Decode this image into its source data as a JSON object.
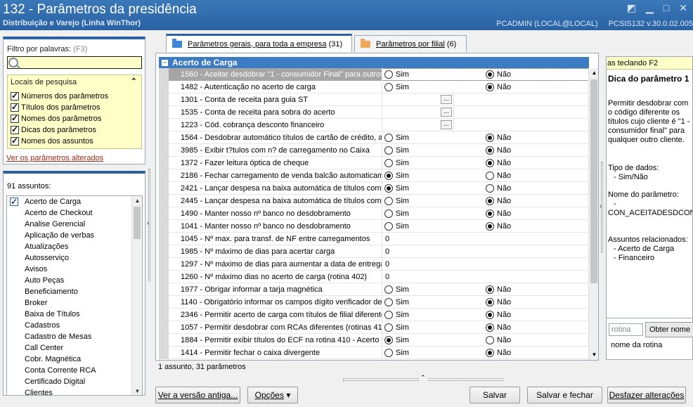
{
  "window": {
    "title": "132 - Parâmetros da presidência",
    "subtitle": "Distribuição e Varejo (Linha WinThor)",
    "user": "PCADMIN (LOCAL@LOCAL)",
    "version": "PCSIS132 v.30.0.02.005"
  },
  "filter": {
    "label": "Filtro por palavras:",
    "shortcut": "(F3)",
    "value": "",
    "locais_title": "Locais de pesquisa",
    "options": [
      {
        "label": "Números dos parâmetros",
        "checked": true
      },
      {
        "label": "Títulos dos parâmetros",
        "checked": true
      },
      {
        "label": "Nomes dos parâmetros",
        "checked": true
      },
      {
        "label": "Dicas dos parâmetros",
        "checked": true
      },
      {
        "label": "Nomes dos assuntos",
        "checked": true
      }
    ],
    "altered_link": "Ver os parâmetros alterados"
  },
  "subjects": {
    "count_label": "91 assuntos:",
    "items": [
      {
        "label": "Acerto de Carga",
        "checked": true
      },
      {
        "label": "Acerto de Checkout",
        "checked": false
      },
      {
        "label": "Analise Gerencial",
        "checked": false
      },
      {
        "label": "Aplicação de verbas",
        "checked": false
      },
      {
        "label": "Atualizações",
        "checked": false
      },
      {
        "label": "Autosserviço",
        "checked": false
      },
      {
        "label": "Avisos",
        "checked": false
      },
      {
        "label": "Auto Peças",
        "checked": false
      },
      {
        "label": "Beneficiamento",
        "checked": false
      },
      {
        "label": "Broker",
        "checked": false
      },
      {
        "label": "Baixa de Títulos",
        "checked": false
      },
      {
        "label": "Cadastros",
        "checked": false
      },
      {
        "label": "Cadastro de Mesas",
        "checked": false
      },
      {
        "label": "Call Center",
        "checked": false
      },
      {
        "label": "Cobr. Magnética",
        "checked": false
      },
      {
        "label": "Conta Corrente RCA",
        "checked": false
      },
      {
        "label": "Certificado Digital",
        "checked": false
      },
      {
        "label": "Clientes",
        "checked": false
      }
    ]
  },
  "tabs": [
    {
      "label": "Parâmetros gerais, para toda a empresa",
      "count": "(31)",
      "color": "#3d86d8"
    },
    {
      "label": "Parâmetros por filial",
      "count": "(6)",
      "color": "#f2a65a"
    }
  ],
  "grid": {
    "group": "Acerto de Carga",
    "sim_label": "Sim",
    "nao_label": "Não",
    "dots_label": "...",
    "rows": [
      {
        "name": "1560 - Aceitar desdobrar \"1 - consumidor Final\" para outros",
        "type": "radio",
        "value": "nao",
        "selected": true
      },
      {
        "name": "1482 - Autenticação no acerto de carga",
        "type": "radio",
        "value": "nao"
      },
      {
        "name": "1301 - Conta de receita para guia ST",
        "type": "button"
      },
      {
        "name": "1535 - Conta de receita para sobra do acerto",
        "type": "button"
      },
      {
        "name": "1223 - Cód. cobrança desconto financeiro",
        "type": "button"
      },
      {
        "name": "1564 - Desdobrar automático títulos de cartão de crédito, a",
        "type": "radio",
        "value": "nao"
      },
      {
        "name": "3985 - Exibir t?tulos com n? de carregamento no Caixa",
        "type": "radio",
        "value": "nao"
      },
      {
        "name": "1372 - Fazer leitura óptica de cheque",
        "type": "radio",
        "value": "nao"
      },
      {
        "name": "2186 - Fechar carregamento de venda balcão automaticame",
        "type": "radio",
        "value": "sim"
      },
      {
        "name": "2421 - Lançar despesa na baixa automática de títulos com c",
        "type": "radio",
        "value": "sim"
      },
      {
        "name": "2445 - Lançar despesa na baixa automática de títulos com c",
        "type": "radio",
        "value": "nao"
      },
      {
        "name": "1490 - Manter nosso nº banco no desdobramento",
        "type": "radio",
        "value": "nao"
      },
      {
        "name": "1041 - Manter nosso nº banco no desdobramento",
        "type": "radio",
        "value": "nao"
      },
      {
        "name": "1045 - Nº max. para transf. de NF entre carregamentos",
        "type": "number",
        "value": "0"
      },
      {
        "name": "1985 - Nº máximo de dias para acertar carga",
        "type": "number",
        "value": "0"
      },
      {
        "name": "1297 - Nº máximo de dias para aumentar a data de entrega",
        "type": "number",
        "value": "0"
      },
      {
        "name": "1260 - Nº máximo dias no acerto de carga (rotina 402)",
        "type": "number",
        "value": "0"
      },
      {
        "name": "1977 - Obrigar informar a tarja magnética",
        "type": "radio",
        "value": "nao"
      },
      {
        "name": "1140 - Obrigatório informar os campos dígito verificador de",
        "type": "radio",
        "value": "nao"
      },
      {
        "name": "2346 - Permitir acerto de carga com títulos de filial diferente",
        "type": "radio",
        "value": "nao"
      },
      {
        "name": "1057 - Permitir desdobrar com RCAs diferentes (rotinas 410",
        "type": "radio",
        "value": "nao"
      },
      {
        "name": "1884 - Permitir exibir títulos do ECF na rotina 410 - Acerto d",
        "type": "radio",
        "value": "sim"
      },
      {
        "name": "1414 - Permitir fechar o caixa divergente",
        "type": "radio",
        "value": "nao"
      }
    ]
  },
  "status_text": "1 assunto, 31 parâmetros",
  "hint": {
    "bar": "as teclando F2",
    "title": "Dica do parâmetro 1",
    "text": "Permitir desdobrar com o código diferente os títulos cujo cliente é \"1 - consumidor final\" para qualquer outro cliente.",
    "tipo_label": "Tipo de dados:",
    "tipo_value": "- Sim/Não",
    "nome_label": "Nome do parâmetro:",
    "nome_dash": "-",
    "nome_value": "CON_ACEITADESDCON",
    "assuntos_label": "Assuntos relacionados:",
    "assuntos": [
      "- Acerto de Carga",
      "- Financeiro"
    ]
  },
  "rotina": {
    "placeholder": "rotina",
    "button": "Obter nome",
    "label": "nome da rotina"
  },
  "buttons": {
    "versao_antiga": "Ver a versão antiga...",
    "opcoes": "Opções",
    "salvar": "Salvar",
    "salvar_fechar": "Salvar e fechar",
    "desfazer": "Desfazer alterações"
  },
  "colors": {
    "accent": "#2a62a4",
    "group_header": "#3d7cc2",
    "highlight": "#ffffc8"
  }
}
